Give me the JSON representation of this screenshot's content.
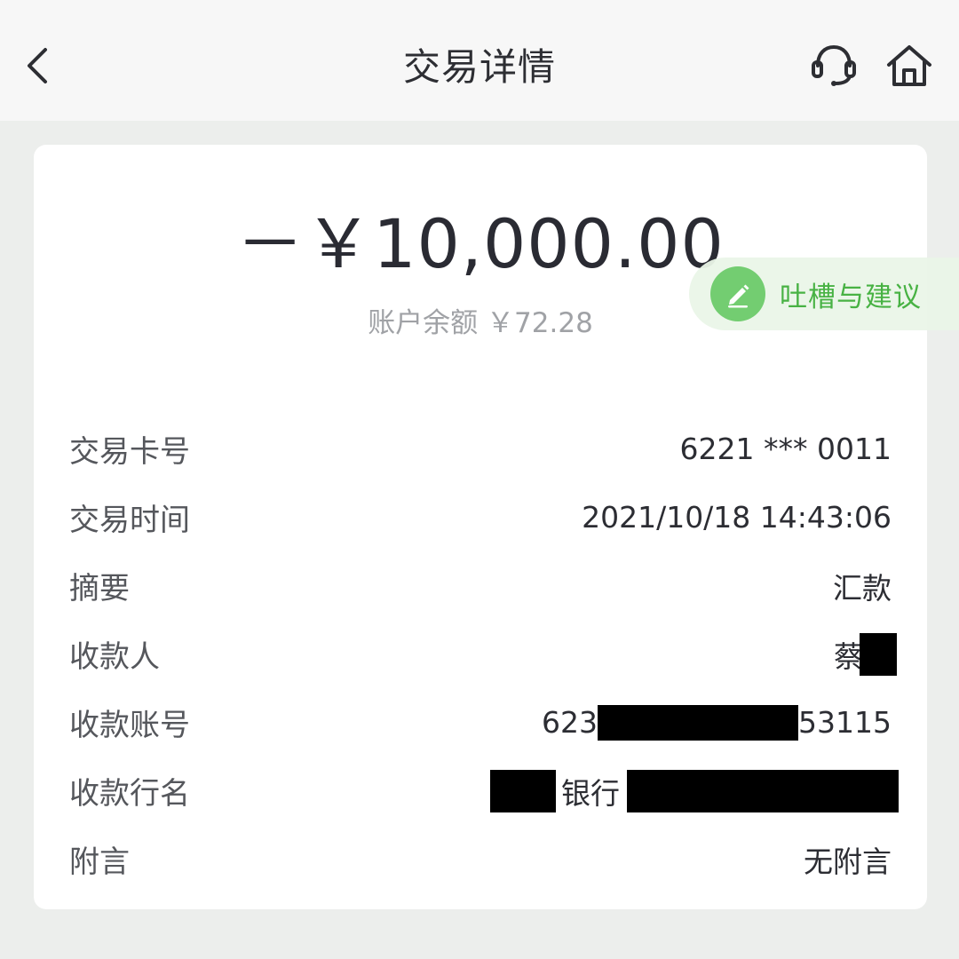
{
  "header": {
    "title": "交易详情"
  },
  "summary": {
    "amount": "－￥10,000.00",
    "balance_label": "账户余额",
    "balance_value": "￥72.28"
  },
  "feedback": {
    "label": "吐槽与建议"
  },
  "details": {
    "card_no": {
      "label": "交易卡号",
      "value": "6221 *** 0011"
    },
    "time": {
      "label": "交易时间",
      "value": "2021/10/18 14:43:06"
    },
    "summary": {
      "label": "摘要",
      "value": "汇款"
    },
    "payee": {
      "label": "收款人",
      "value_visible": "蔡"
    },
    "payee_account": {
      "label": "收款账号",
      "value_prefix": "623",
      "value_suffix": "53115"
    },
    "payee_bank": {
      "label": "收款行名",
      "value_visible": "银行"
    },
    "note": {
      "label": "附言",
      "value": "无附言"
    }
  },
  "colors": {
    "accent_green": "#3fae3a",
    "icon_green": "#6ccb6a",
    "text_dark": "#2c2d33",
    "text_gray": "#a0a2a6"
  }
}
